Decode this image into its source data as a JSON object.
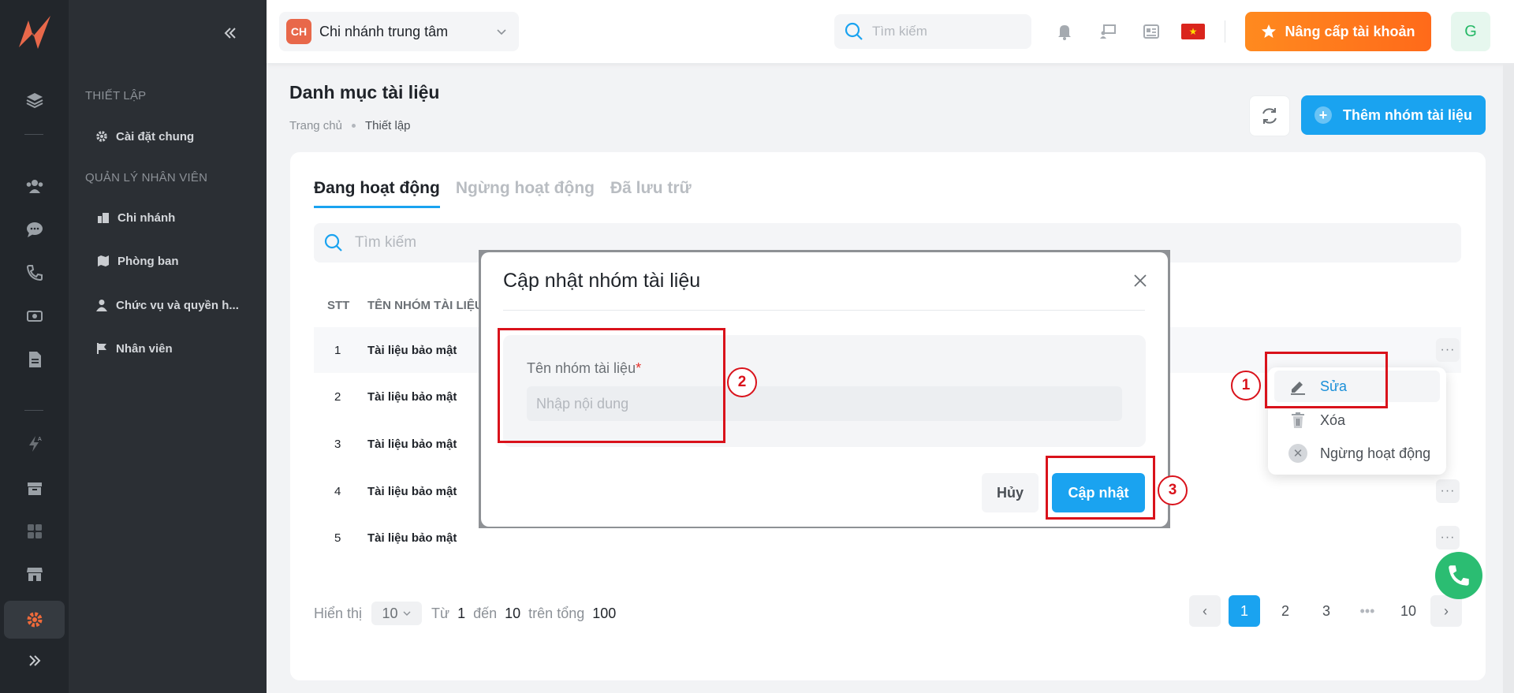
{
  "colors": {
    "accent": "#1aa3f0",
    "upgrade": "#ff7a1a",
    "annotation": "#d9121b",
    "success": "#2bbd72"
  },
  "rail": {
    "icons": [
      "logo-icon",
      "layers-icon",
      "users-icon",
      "chat-icon",
      "phone-icon",
      "money-icon",
      "document-icon",
      "automation-icon",
      "archive-icon",
      "apps-icon",
      "store-icon",
      "settings-icon",
      "expand-icon"
    ]
  },
  "sidebar": {
    "section_setup": "THIẾT LẬP",
    "general_settings": "Cài đặt chung",
    "section_staff": "QUẢN LÝ NHÂN VIÊN",
    "items": [
      {
        "label": "Chi nhánh",
        "icon": "building-icon"
      },
      {
        "label": "Phòng ban",
        "icon": "map-icon"
      },
      {
        "label": "Chức vụ và quyền h...",
        "icon": "user-icon"
      },
      {
        "label": "Nhân viên",
        "icon": "flag-icon"
      }
    ]
  },
  "topbar": {
    "branch_badge": "CH",
    "branch_name": "Chi nhánh trung tâm",
    "search_placeholder": "Tìm kiếm",
    "upgrade_label": "Nâng cấp tài khoản",
    "avatar_initial": "G",
    "flag_star": "★"
  },
  "page": {
    "title": "Danh mục tài liệu",
    "breadcrumb_home": "Trang chủ",
    "breadcrumb_current": "Thiết lập",
    "add_button": "Thêm nhóm tài liệu",
    "add_plus": "+"
  },
  "tabs": [
    "Đang hoạt động",
    "Ngừng hoạt động",
    "Đã lưu trữ"
  ],
  "table": {
    "search_placeholder": "Tìm kiếm",
    "headers": {
      "stt": "STT",
      "name": "TÊN NHÓM TÀI LIỆU"
    },
    "rows": [
      {
        "stt": "1",
        "name": "Tài liệu bảo mật"
      },
      {
        "stt": "2",
        "name": "Tài liệu bảo mật"
      },
      {
        "stt": "3",
        "name": "Tài liệu bảo mật"
      },
      {
        "stt": "4",
        "name": "Tài liệu bảo mật"
      },
      {
        "stt": "5",
        "name": "Tài liệu bảo mật"
      }
    ],
    "row_menu": "···"
  },
  "pagination": {
    "show_label": "Hiển thị",
    "page_size": "10",
    "from_label": "Từ",
    "from": "1",
    "to_label": "đến",
    "to": "10",
    "total_label": "trên tổng",
    "total": "100",
    "pages": [
      "1",
      "2",
      "3",
      "•••",
      "10"
    ],
    "current_page": "1",
    "prev": "‹",
    "next": "›"
  },
  "context_menu": {
    "edit": "Sửa",
    "delete": "Xóa",
    "deactivate": "Ngừng hoạt động",
    "deactivate_glyph": "✕"
  },
  "modal": {
    "title": "Cập nhật nhóm tài liệu",
    "field_label": "Tên nhóm tài liệu",
    "required_mark": "*",
    "field_placeholder": "Nhập nội dung",
    "field_value": "",
    "cancel": "Hủy",
    "submit": "Cập nhật"
  },
  "annotations": [
    "1",
    "2",
    "3"
  ]
}
